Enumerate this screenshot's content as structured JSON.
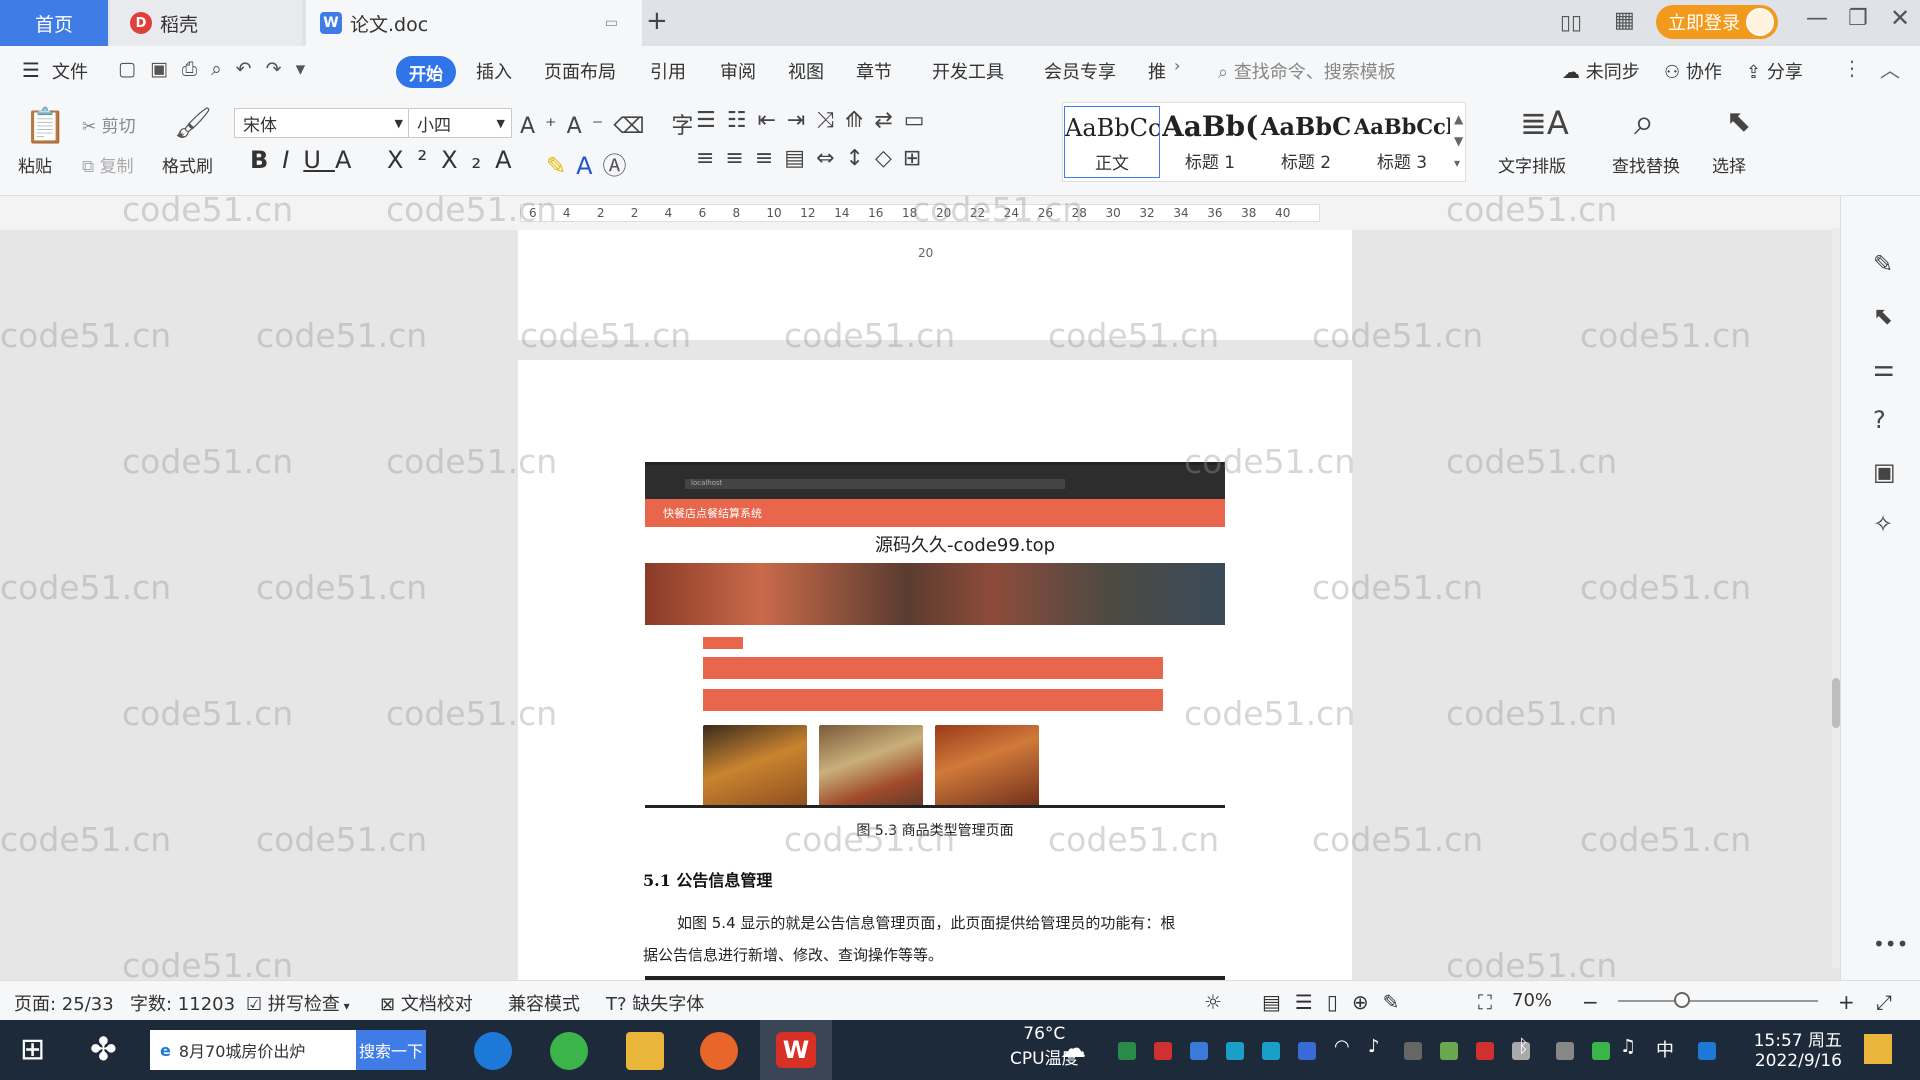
{
  "titlebar": {
    "tabs": [
      {
        "label": "首页"
      },
      {
        "label": "稻壳"
      },
      {
        "label": "论文.doc"
      }
    ],
    "new_tab": "+",
    "login": "立即登录"
  },
  "menu": {
    "file": "文件",
    "items": [
      "开始",
      "插入",
      "页面布局",
      "引用",
      "审阅",
      "视图",
      "章节",
      "开发工具",
      "会员专享",
      "推"
    ],
    "search_placeholder": "查找命令、搜索模板",
    "sync": "未同步",
    "collab": "协作",
    "share": "分享"
  },
  "ribbon": {
    "paste": "粘贴",
    "cut": "剪切",
    "copy": "复制",
    "format_painter": "格式刷",
    "font_name": "宋体",
    "font_size": "小四",
    "styles": [
      {
        "preview": "AaBbCcI",
        "label": "正文"
      },
      {
        "preview": "AaBb(",
        "label": "标题 1"
      },
      {
        "preview": "AaBbC",
        "label": "标题 2"
      },
      {
        "preview": "AaBbCcl",
        "label": "标题 3"
      }
    ],
    "text_layout": "文字排版",
    "find_replace": "查找替换",
    "select": "选择"
  },
  "ruler": {
    "ticks": [
      "6",
      "4",
      "2",
      "2",
      "4",
      "6",
      "8",
      "10",
      "12",
      "14",
      "16",
      "18",
      "20",
      "22",
      "24",
      "26",
      "28",
      "30",
      "32",
      "34",
      "36",
      "38",
      "40"
    ]
  },
  "document": {
    "page_number": "20",
    "figure_caption": "图 5.3  商品类型管理页面",
    "heading": "5.1 公告信息管理",
    "paragraph_line1": "如图 5.4 显示的就是公告信息管理页面，此页面提供给管理员的功能有：根",
    "paragraph_line2": "据公告信息进行新增、修改、查询操作等等。",
    "screenshot": {
      "site_title": "快餐店点餐结算系统",
      "overlay_text": "源码久久-code99.top",
      "url": "localhost"
    },
    "watermark": "code51.cn"
  },
  "statusbar": {
    "page": "页面: 25/33",
    "words": "字数: 11203",
    "spellcheck": "拼写检查",
    "proofread": "文档校对",
    "compat": "兼容模式",
    "missing_font": "缺失字体",
    "zoom": "70%"
  },
  "taskbar": {
    "search_text": "8月70城房价出炉",
    "search_button": "搜索一下",
    "temp": "76°C",
    "temp_label": "CPU温度",
    "ime": "中",
    "time": "15:57 周五",
    "date": "2022/9/16"
  },
  "colors": {
    "accent": "#2f74e8",
    "login": "#f39a1d",
    "site_header": "#e8664b",
    "taskbar": "#1d2a3a"
  }
}
